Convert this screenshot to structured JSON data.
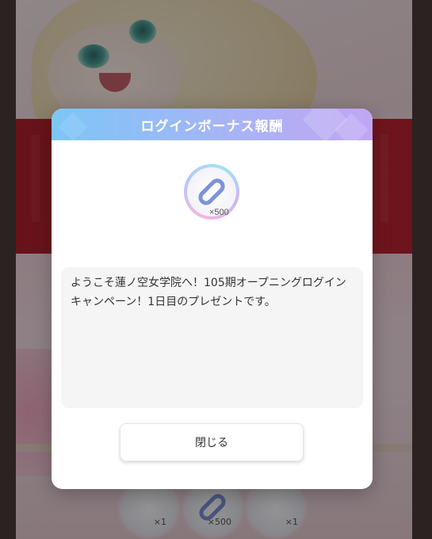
{
  "dialog": {
    "title": "ログインボーナス報酬",
    "reward": {
      "icon": "s-currency-icon",
      "quantity": "×500"
    },
    "message": "ようこそ蓮ノ空女学院へ！105期オープニングログインキャンペーン！1日目のプレゼントです。",
    "close_label": "閉じる"
  },
  "background": {
    "items": [
      {
        "count": "×1"
      },
      {
        "count": "×500"
      },
      {
        "count": "×1"
      }
    ]
  },
  "colors": {
    "header_start": "#7cc6f6",
    "header_end": "#c0a6f3",
    "currency_icon": "#7d92d8"
  }
}
